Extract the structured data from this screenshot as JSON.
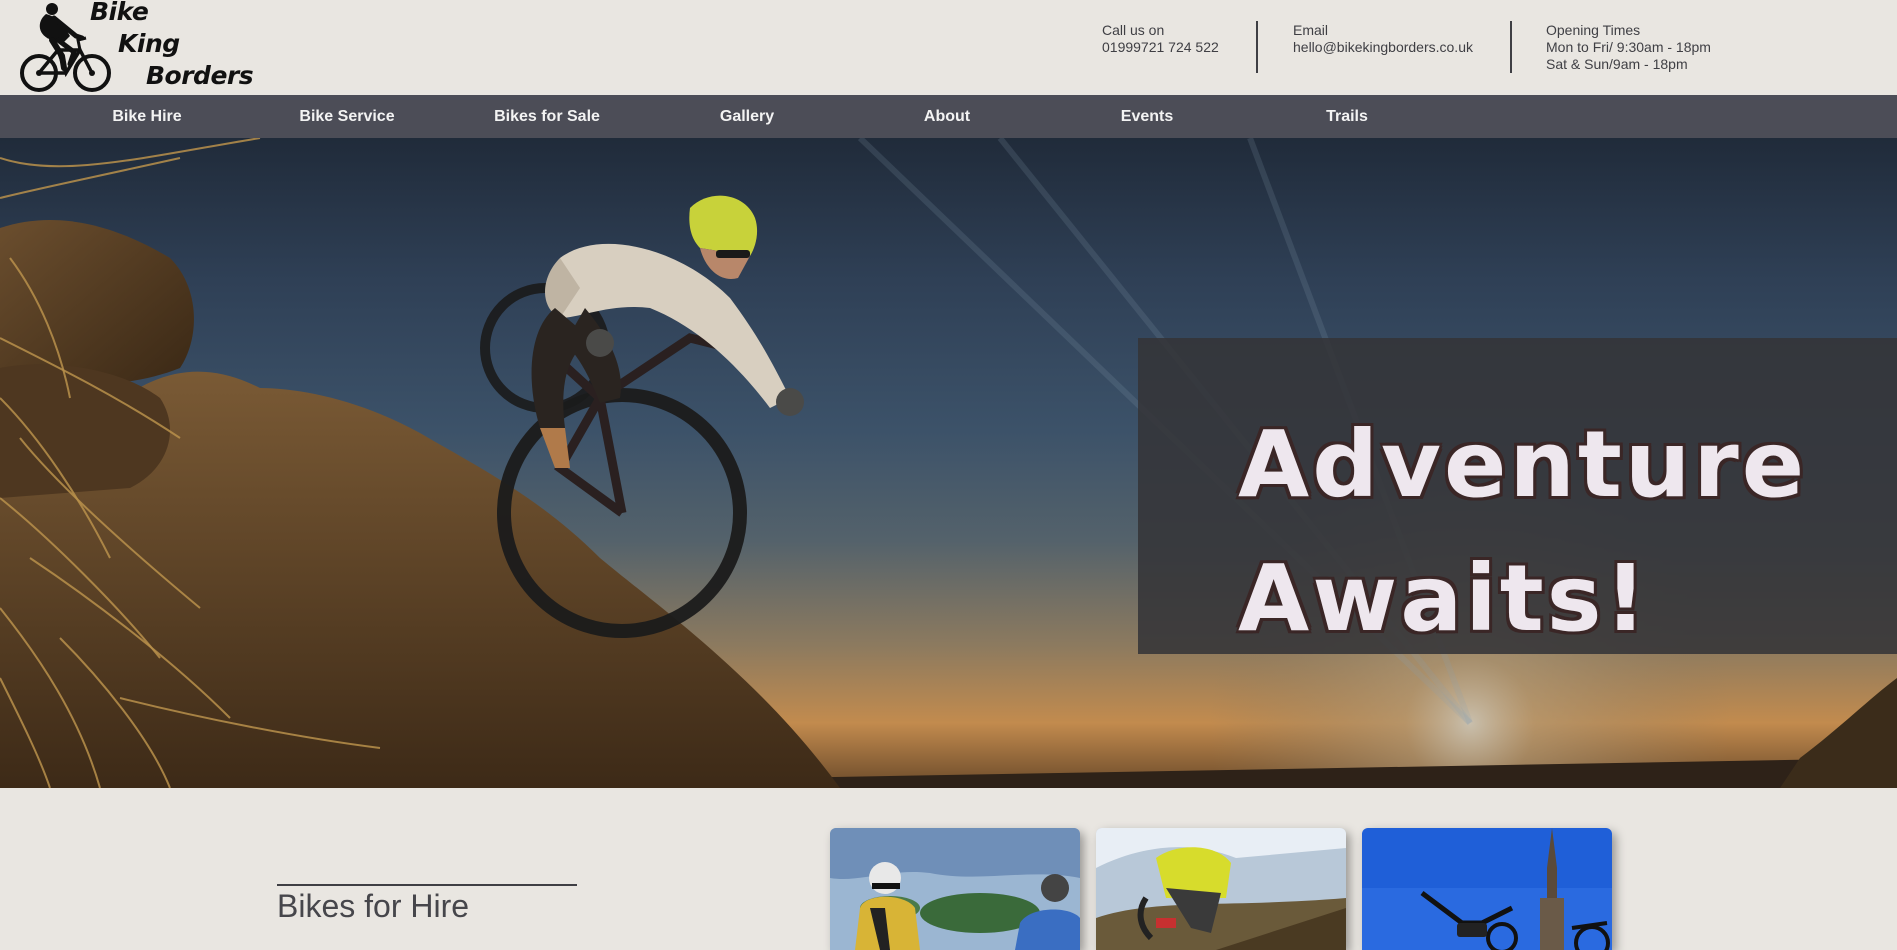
{
  "brand": {
    "logo_line1": "Bike",
    "logo_line2": "King",
    "logo_line3": "Borders"
  },
  "contact": {
    "phone_label": "Call us on",
    "phone_value": "01999721 724 522",
    "email_label": "Email",
    "email_value": "hello@bikekingborders.co.uk",
    "hours_label": "Opening Times",
    "hours_weekday": "Mon to Fri/ 9:30am - 18pm",
    "hours_weekend": "Sat & Sun/9am - 18pm"
  },
  "nav": {
    "items": [
      "Bike Hire",
      "Bike Service",
      "Bikes for Sale",
      "Gallery",
      "About",
      "Events",
      "Trails"
    ]
  },
  "hero": {
    "title_line1": "Adventure",
    "title_line2": "Awaits!"
  },
  "section": {
    "title": "Bikes for Hire"
  },
  "colors": {
    "background": "#e9e6e1",
    "nav": "#4c4d57",
    "text": "#3f3f44",
    "hero_panel": "#343438"
  }
}
